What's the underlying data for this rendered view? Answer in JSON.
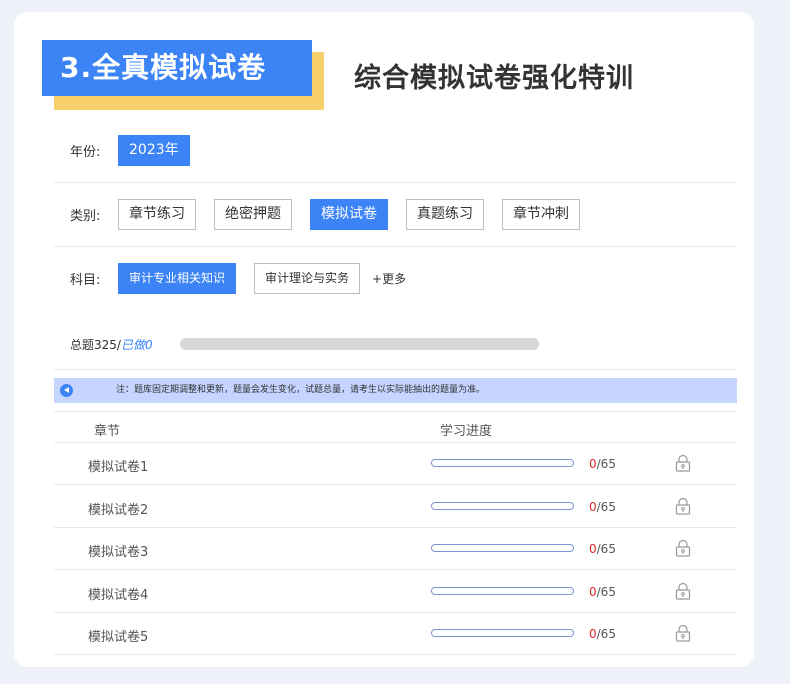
{
  "header": {
    "badge": "3.全真模拟试卷",
    "subtitle": "综合模拟试卷强化特训"
  },
  "filters": {
    "year": {
      "label": "年份:",
      "options": [
        "2023年"
      ],
      "active": 0
    },
    "category": {
      "label": "类别:",
      "options": [
        "章节练习",
        "绝密押题",
        "模拟试卷",
        "真题练习",
        "章节冲刺"
      ],
      "active": 2
    },
    "subject": {
      "label": "科目:",
      "options": [
        "审计专业相关知识",
        "审计理论与实务"
      ],
      "active": 0,
      "more": "+更多"
    }
  },
  "summary": {
    "total_prefix": "总题",
    "total": "325",
    "sep": "/",
    "done_label": "已做0",
    "progress": 0
  },
  "notice": {
    "text": "注：题库固定期调整和更新，题量会发生变化，试题总量，请考生以实际能抽出的题量为准。",
    "icon": "speaker-icon"
  },
  "table": {
    "headers": [
      "章节",
      "学习进度"
    ],
    "rows": [
      {
        "name": "模拟试卷1",
        "done": "0",
        "total": "/65",
        "progress": 0
      },
      {
        "name": "模拟试卷2",
        "done": "0",
        "total": "/65",
        "progress": 0
      },
      {
        "name": "模拟试卷3",
        "done": "0",
        "total": "/65",
        "progress": 0
      },
      {
        "name": "模拟试卷4",
        "done": "0",
        "total": "/65",
        "progress": 0
      },
      {
        "name": "模拟试卷5",
        "done": "0",
        "total": "/65",
        "progress": 0
      }
    ]
  },
  "colors": {
    "accent": "#3c84f6",
    "highlight": "#f7cf6b",
    "notice_bg": "#c6d5ff",
    "done_red": "#e0262b",
    "bar": "#7d96cf"
  }
}
